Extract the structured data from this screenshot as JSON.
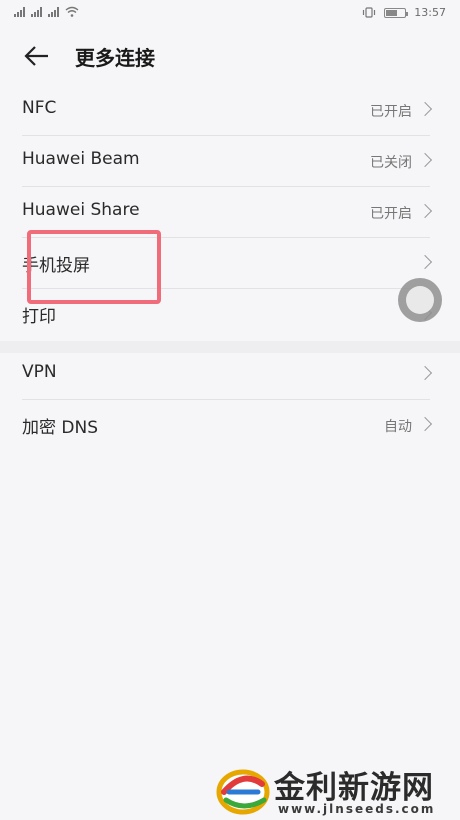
{
  "status_bar": {
    "time": "13:57"
  },
  "header": {
    "title": "更多连接"
  },
  "section1": {
    "rows": [
      {
        "label": "NFC",
        "value": "已开启"
      },
      {
        "label": "Huawei Beam",
        "value": "已关闭"
      },
      {
        "label": "Huawei Share",
        "value": "已开启"
      },
      {
        "label": "手机投屏",
        "value": ""
      },
      {
        "label": "打印",
        "value": ""
      }
    ]
  },
  "section2": {
    "rows": [
      {
        "label": "VPN",
        "value": ""
      },
      {
        "label": "加密 DNS",
        "value": "自动"
      }
    ]
  },
  "watermark": {
    "title": "金利新游网",
    "url": "www.jlnseeds.com"
  },
  "colors": {
    "highlight": "#f06c7a",
    "background": "#f6f5f7"
  },
  "battery_level": 0.6
}
